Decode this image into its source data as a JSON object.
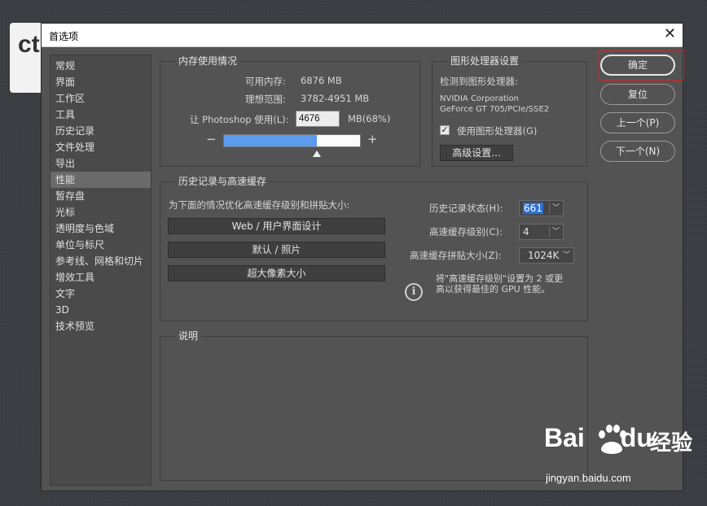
{
  "background_card_text": "ct",
  "dialog": {
    "title": "首选项",
    "close_symbol": "✕"
  },
  "sidebar": {
    "items": [
      "常规",
      "界面",
      "工作区",
      "工具",
      "历史记录",
      "文件处理",
      "导出",
      "性能",
      "暂存盘",
      "光标",
      "透明度与色域",
      "单位与标尺",
      "参考线、网格和切片",
      "增效工具",
      "文字",
      "3D",
      "技术预览"
    ],
    "selected": "性能"
  },
  "memory": {
    "title": "内存使用情况",
    "available_label": "可用内存:",
    "available_value": "6876 MB",
    "ideal_label": "理想范围:",
    "ideal_value": "3782-4951 MB",
    "let_label": "让 Photoshop 使用(L):",
    "let_value": "4676",
    "unit_pct": "MB(68%)",
    "minus": "−",
    "plus": "+",
    "usage_fraction": 0.68
  },
  "gpu": {
    "title": "图形处理器设置",
    "detected_label": "检测到图形处理器:",
    "vendor": "NVIDIA Corporation",
    "model": "GeForce GT 705/PCIe/SSE2",
    "use_gpu_label": "使用图形处理器(G)",
    "use_gpu_checked": true,
    "advanced_button": "高级设置..."
  },
  "history_cache": {
    "title": "历史记录与高速缓存",
    "optimize_label": "为下面的情况优化高速缓存级别和拼贴大小:",
    "presets": [
      "Web / 用户界面设计",
      "默认 / 照片",
      "超大像素大小"
    ],
    "history_states_label": "历史记录状态(H):",
    "history_states_value": "661",
    "cache_levels_label": "高速缓存级别(C):",
    "cache_levels_value": "4",
    "tile_size_label": "高速缓存拼贴大小(Z):",
    "tile_size_value": "1024K",
    "tip_line1": "将\"高速缓存级别\"设置为 2 或更",
    "tip_line2": "高以获得最佳的 GPU 性能。"
  },
  "description": {
    "title": "说明"
  },
  "buttons": {
    "ok": "确定",
    "reset": "复位",
    "prev": "上一个(P)",
    "next": "下一个(N)"
  },
  "watermark": {
    "logo": "Bai",
    "logo_end": "du",
    "brand": "经验",
    "url": "jingyan.baidu.com"
  },
  "colors": {
    "dialog_bg": "#535353",
    "accent": "#5b9bef",
    "highlight_box": "#e02020"
  }
}
